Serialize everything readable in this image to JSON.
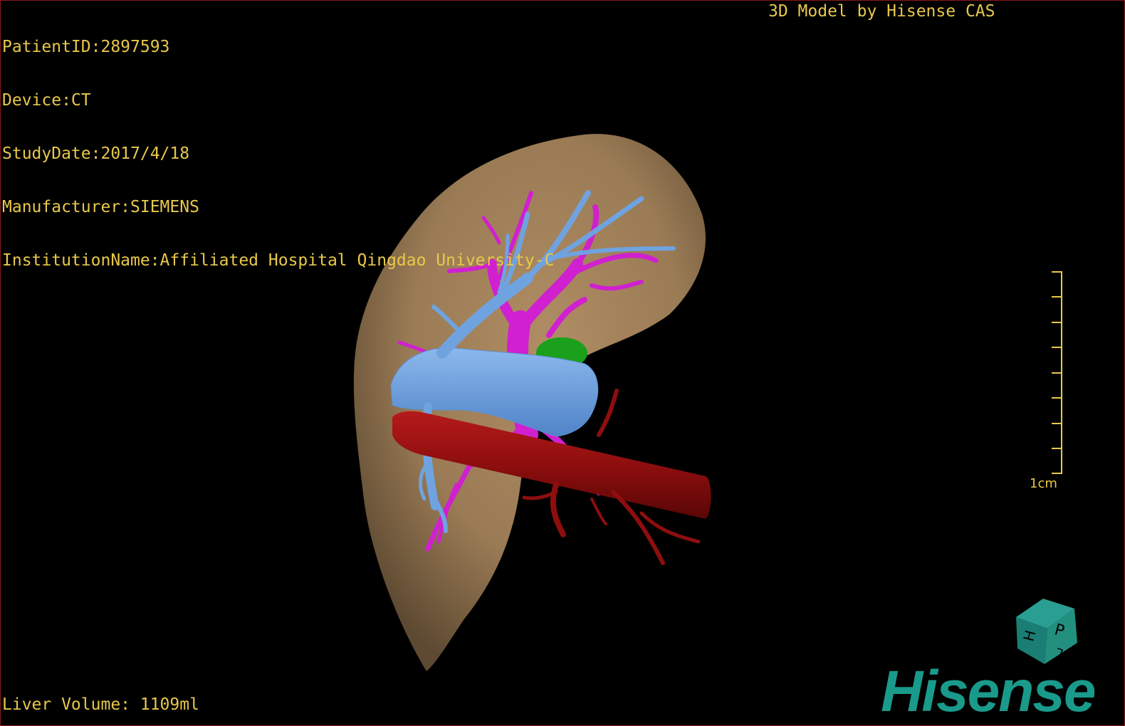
{
  "header": {
    "patient_id": "PatientID:2897593",
    "device": "Device:CT",
    "study_date": "StudyDate:2017/4/18",
    "manufacturer": "Manufacturer:SIEMENS",
    "institution": "InstitutionName:Affiliated Hospital Qingdao University-C"
  },
  "credit": "3D Model by Hisense CAS",
  "footer": {
    "liver_volume": "Liver Volume: 1109ml"
  },
  "scale": {
    "label": "1cm"
  },
  "orientation_cube": {
    "face_top": "H",
    "face_front": "P",
    "face_side": "L"
  },
  "brand": {
    "name": "Hisense",
    "color": "#1a9a8a"
  },
  "colors": {
    "overlay_text": "#e8c84a",
    "liver": "#9c7e5a",
    "hepatic_vein": "#6fa3e0",
    "portal_vein": "#d020d0",
    "inferior_vena_cava": "#9a1010",
    "gallbladder": "#18a018",
    "background": "#000000"
  }
}
